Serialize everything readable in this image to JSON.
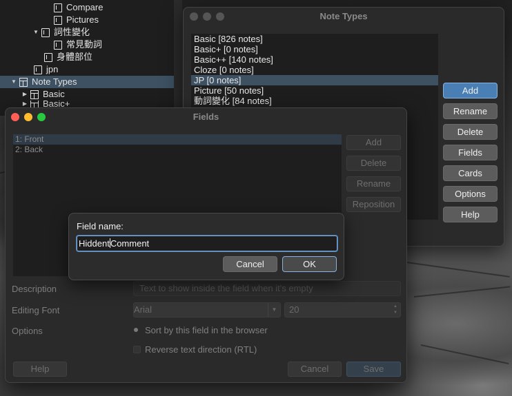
{
  "browser": {
    "tree": [
      {
        "label": "Compare"
      },
      {
        "label": "Pictures"
      },
      {
        "label": "詞性變化"
      },
      {
        "label": "常見動詞"
      },
      {
        "label": "身體部位"
      },
      {
        "label": "jpn"
      },
      {
        "label": "Note Types"
      },
      {
        "label": "Basic"
      },
      {
        "label": "Basic+"
      }
    ]
  },
  "note_types": {
    "title": "Note Types",
    "items": [
      {
        "label": "Basic [826 notes]"
      },
      {
        "label": "Basic+ [0 notes]"
      },
      {
        "label": "Basic++ [140 notes]"
      },
      {
        "label": "Cloze [0 notes]"
      },
      {
        "label": "JP [0 notes]"
      },
      {
        "label": "Picture [50 notes]"
      },
      {
        "label": "動詞變化 [84 notes]"
      }
    ],
    "selected_index": 4,
    "buttons": {
      "add": "Add",
      "rename": "Rename",
      "delete": "Delete",
      "fields": "Fields",
      "cards": "Cards",
      "options": "Options",
      "help": "Help"
    }
  },
  "fields": {
    "title": "Fields",
    "items": [
      {
        "label": "1: Front"
      },
      {
        "label": "2: Back"
      }
    ],
    "buttons": {
      "add": "Add",
      "delete": "Delete",
      "rename": "Rename",
      "reposition": "Reposition"
    },
    "description_label": "Description",
    "description_placeholder": "Text to show inside the field when it's empty",
    "editing_font_label": "Editing Font",
    "font_value": "Arial",
    "font_size": "20",
    "options_label": "Options",
    "sort_option": "Sort by this field in the browser",
    "rtl_option": "Reverse text direction (RTL)",
    "help_button": "Help",
    "cancel_button": "Cancel",
    "save_button": "Save"
  },
  "prompt": {
    "label": "Field name:",
    "value_before_cursor": "Hiddent",
    "value_after_cursor": "Comment",
    "cancel": "Cancel",
    "ok": "OK"
  },
  "colors": {
    "selection": "#3d5163",
    "accent": "#4a7fb5"
  }
}
